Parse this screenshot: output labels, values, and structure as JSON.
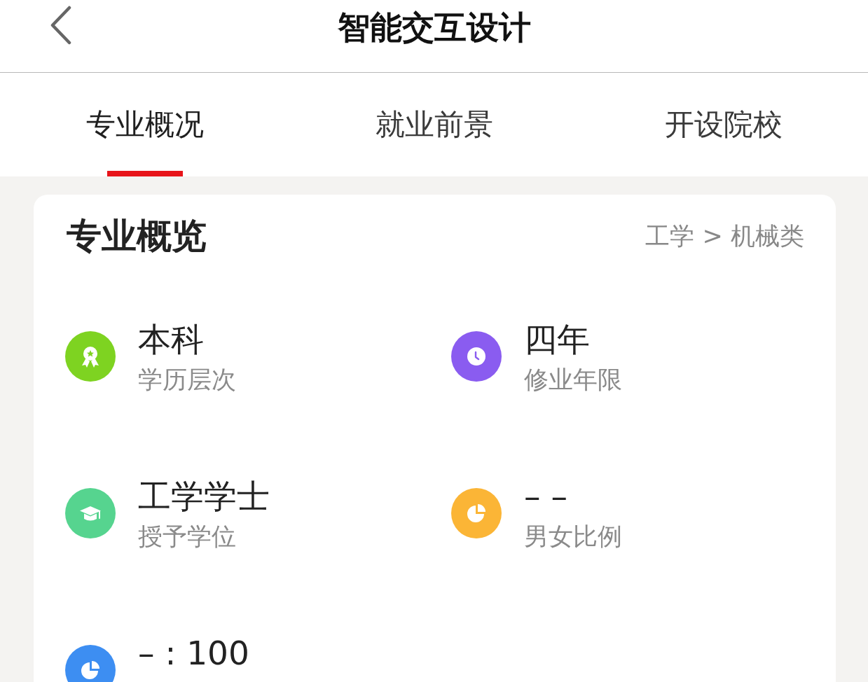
{
  "header": {
    "title": "智能交互设计"
  },
  "tabs": [
    {
      "label": "专业概况",
      "selected": true
    },
    {
      "label": "就业前景",
      "selected": false
    },
    {
      "label": "开设院校",
      "selected": false
    }
  ],
  "overview": {
    "title": "专业概览",
    "category_path": "工学 > 机械类",
    "items": [
      {
        "kind": "award",
        "color": "#7ed321",
        "value": "本科",
        "label": "学历层次"
      },
      {
        "kind": "clock",
        "color": "#8a5cf0",
        "value": "四年",
        "label": "修业年限"
      },
      {
        "kind": "cap",
        "color": "#56d48f",
        "value": "工学学士",
        "label": "授予学位"
      },
      {
        "kind": "pie",
        "color": "#fbb536",
        "value": "– –",
        "label": "男女比例"
      },
      {
        "kind": "pie",
        "color": "#3d8ef2",
        "value": "– : 100"
      }
    ]
  }
}
